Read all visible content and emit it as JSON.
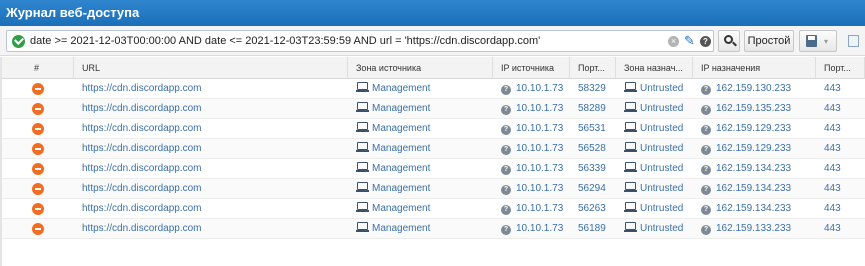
{
  "window": {
    "title": "Журнал веб-доступа"
  },
  "filter": {
    "query": "date >= 2021-12-03T00:00:00 AND date <= 2021-12-03T23:59:59 AND url = 'https://cdn.discordapp.com'",
    "clear_glyph": "×",
    "help_glyph": "?",
    "edit_glyph": "✎"
  },
  "toolbar": {
    "simple_label": "Простой",
    "save_caret": "▾"
  },
  "table": {
    "columns": [
      "#",
      "URL",
      "Зона источника",
      "IP источника",
      "Порт...",
      "Зона назнач...",
      "IP назначения",
      "Порт..."
    ],
    "rows": [
      {
        "url": "https://cdn.discordapp.com",
        "src_zone": "Management",
        "src_ip": "10.10.1.73",
        "src_port": "58329",
        "dst_zone": "Untrusted",
        "dst_ip": "162.159.130.233",
        "dst_port": "443"
      },
      {
        "url": "https://cdn.discordapp.com",
        "src_zone": "Management",
        "src_ip": "10.10.1.73",
        "src_port": "58289",
        "dst_zone": "Untrusted",
        "dst_ip": "162.159.135.233",
        "dst_port": "443"
      },
      {
        "url": "https://cdn.discordapp.com",
        "src_zone": "Management",
        "src_ip": "10.10.1.73",
        "src_port": "56531",
        "dst_zone": "Untrusted",
        "dst_ip": "162.159.129.233",
        "dst_port": "443"
      },
      {
        "url": "https://cdn.discordapp.com",
        "src_zone": "Management",
        "src_ip": "10.10.1.73",
        "src_port": "56528",
        "dst_zone": "Untrusted",
        "dst_ip": "162.159.129.233",
        "dst_port": "443"
      },
      {
        "url": "https://cdn.discordapp.com",
        "src_zone": "Management",
        "src_ip": "10.10.1.73",
        "src_port": "56339",
        "dst_zone": "Untrusted",
        "dst_ip": "162.159.134.233",
        "dst_port": "443"
      },
      {
        "url": "https://cdn.discordapp.com",
        "src_zone": "Management",
        "src_ip": "10.10.1.73",
        "src_port": "56294",
        "dst_zone": "Untrusted",
        "dst_ip": "162.159.134.233",
        "dst_port": "443"
      },
      {
        "url": "https://cdn.discordapp.com",
        "src_zone": "Management",
        "src_ip": "10.10.1.73",
        "src_port": "56263",
        "dst_zone": "Untrusted",
        "dst_ip": "162.159.134.233",
        "dst_port": "443"
      },
      {
        "url": "https://cdn.discordapp.com",
        "src_zone": "Management",
        "src_ip": "10.10.1.73",
        "src_port": "56189",
        "dst_zone": "Untrusted",
        "dst_ip": "162.159.133.233",
        "dst_port": "443"
      }
    ]
  },
  "colors": {
    "title_bar": "#1f78c1",
    "link": "#3a6fa8",
    "block_action": "#f26d21",
    "filter_valid": "#2f9e44"
  },
  "icons": {
    "row_action": "block-icon",
    "zone": "network-zone-icon",
    "ip": "unknown-host-icon"
  }
}
